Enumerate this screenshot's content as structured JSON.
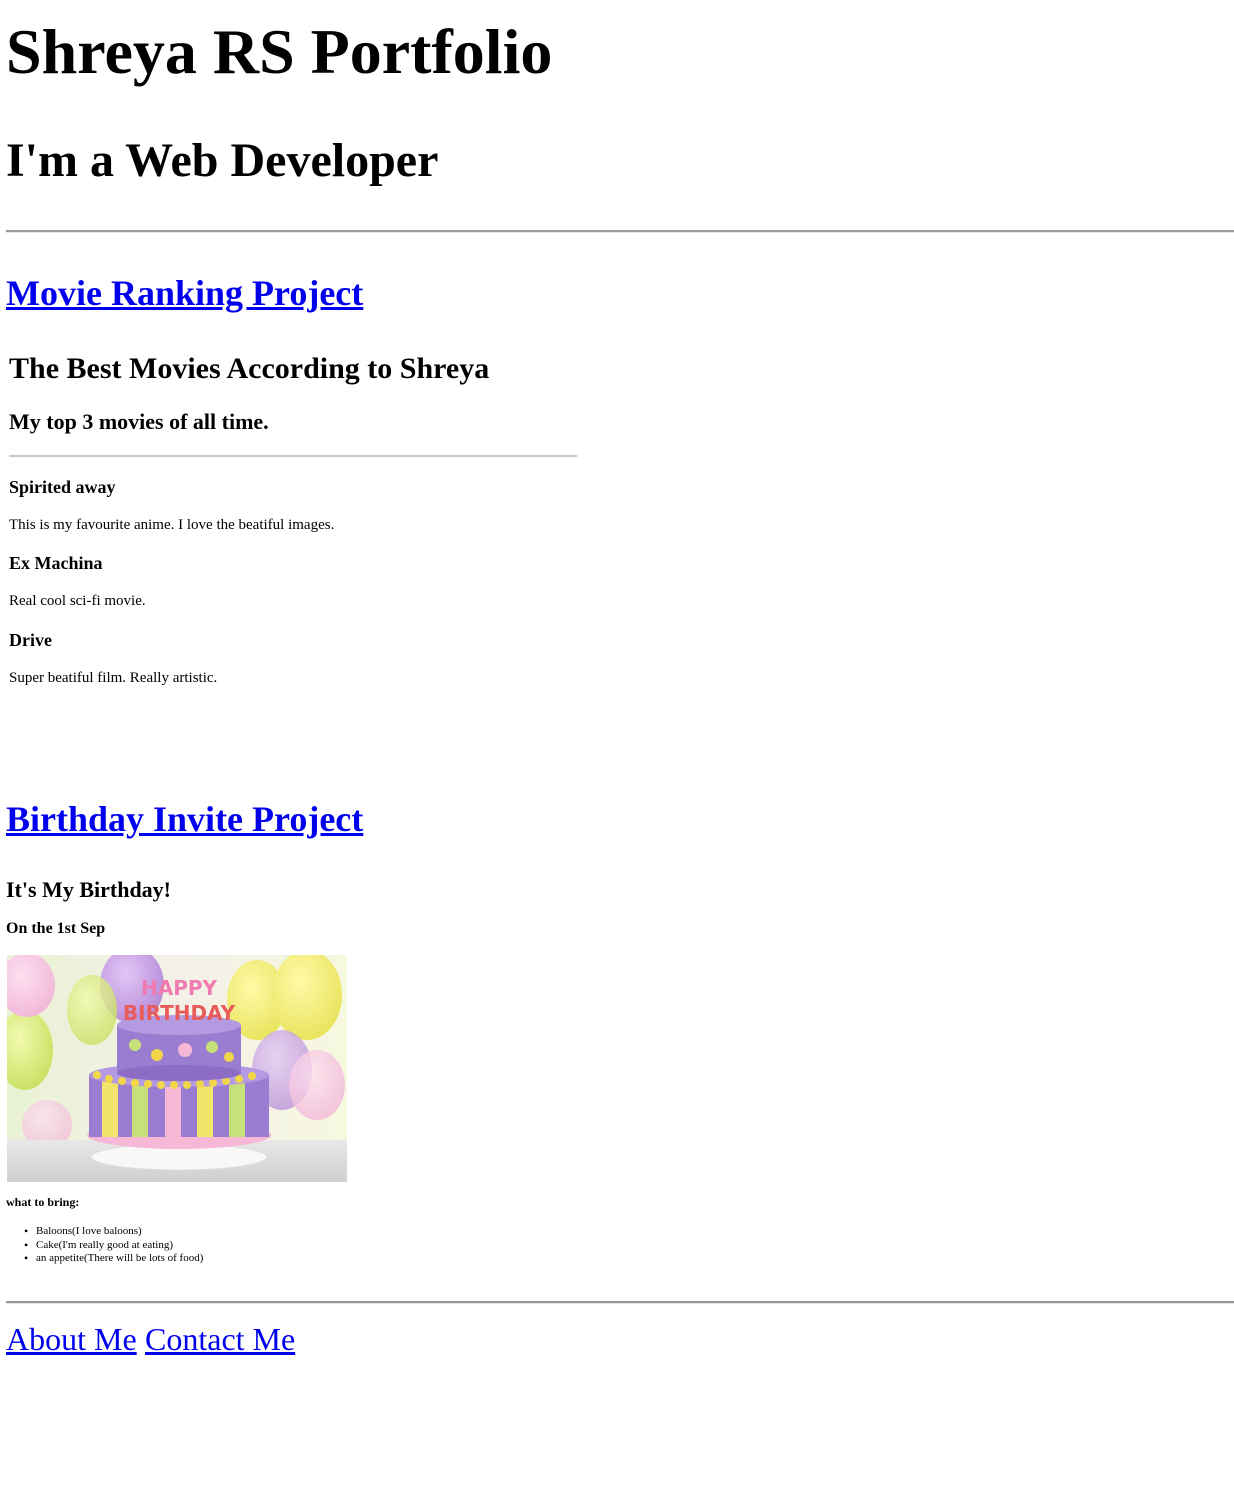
{
  "header": {
    "title": "Shreya RS Portfolio",
    "subtitle": "I'm a Web Developer"
  },
  "projects": {
    "movie_link": "Movie Ranking Project",
    "birthday_link": "Birthday Invite Project"
  },
  "movie_embed": {
    "heading": "The Best Movies According to Shreya",
    "subheading": "My top 3 movies of all time.",
    "movies": [
      {
        "title": "Spirited away",
        "description": "This is my favourite anime. I love the beatiful images."
      },
      {
        "title": "Ex Machina",
        "description": "Real cool sci-fi movie."
      },
      {
        "title": "Drive",
        "description": "Super beatiful film. Really artistic."
      }
    ]
  },
  "birthday": {
    "heading": "It's My Birthday!",
    "date": "On the 1st Sep",
    "image_text": {
      "line1": "HAPPY",
      "line2": "BIRTHDAY"
    },
    "bring_label": "what to bring:",
    "items": [
      "Baloons(I love baloons)",
      "Cake(I'm really good at eating)",
      "an appetite(There will be lots of food)"
    ]
  },
  "footer": {
    "about": "About Me",
    "contact": "Contact Me"
  }
}
